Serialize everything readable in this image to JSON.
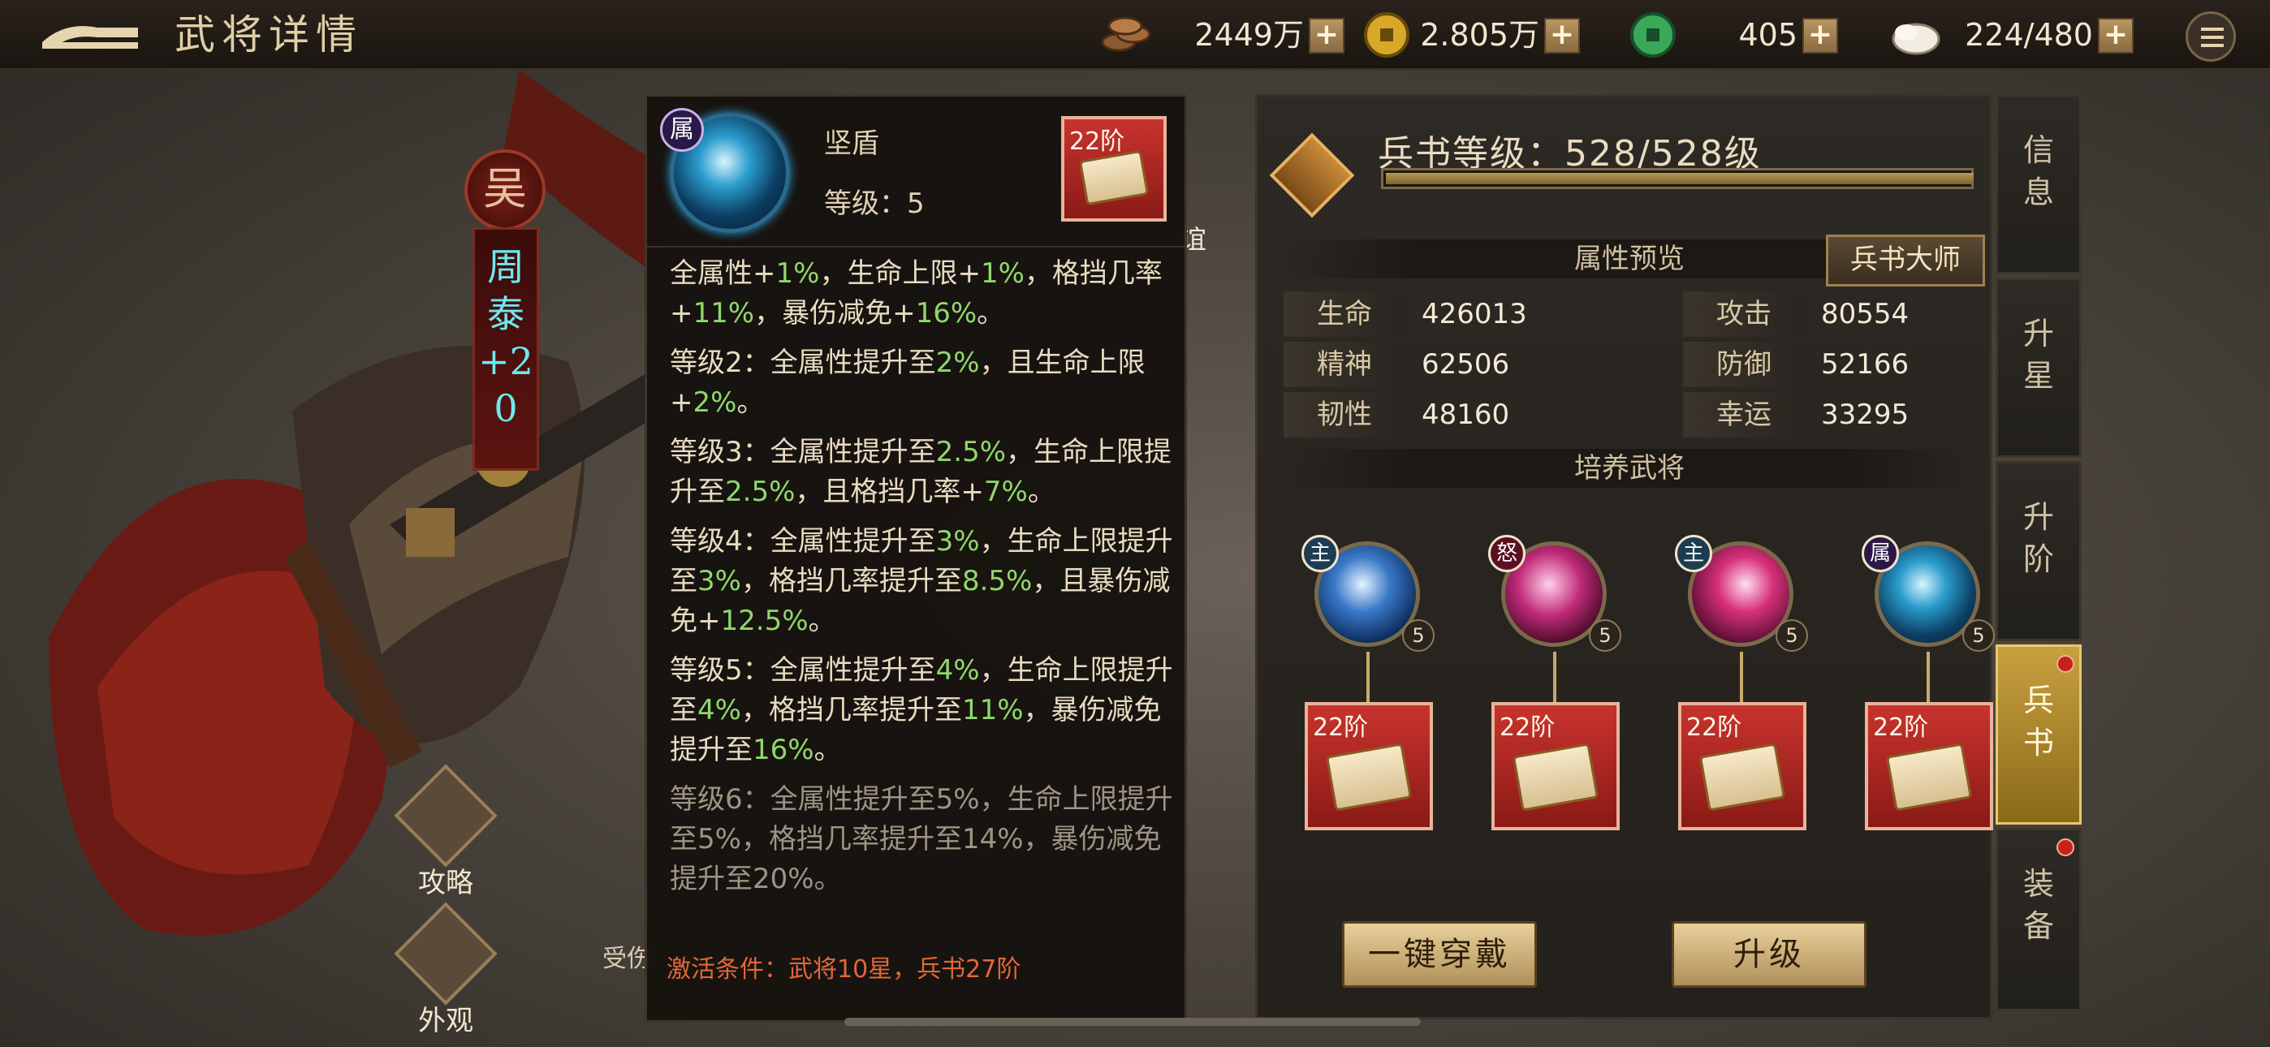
{
  "header": {
    "title": "武将详情",
    "resources": [
      {
        "icon": "copper-coins-icon",
        "value": "2449万"
      },
      {
        "icon": "gold-coin-icon",
        "value": "2.805万"
      },
      {
        "icon": "jade-coin-icon",
        "value": "405"
      },
      {
        "icon": "steamed-bun-icon",
        "value": "224/480"
      }
    ],
    "plus": "+"
  },
  "hero": {
    "faction": "吴",
    "name": "周泰+20",
    "side_buttons": [
      "攻略",
      "外观"
    ],
    "partial_labels": [
      "谊",
      "受伤"
    ]
  },
  "skill_popup": {
    "badge": "属",
    "name": "坚盾",
    "level": "等级：5",
    "book_tier": "22阶",
    "description": [
      {
        "text": "全属性+1%，生命上限+1%，格挡几率+11%，暴伤减免+16%。",
        "segments": [
          {
            "t": "全属性+"
          },
          {
            "t": "1%",
            "c": "green"
          },
          {
            "t": "，生命上限+"
          },
          {
            "t": "1%",
            "c": "green"
          },
          {
            "t": "，格挡几率+"
          },
          {
            "t": "11%",
            "c": "green"
          },
          {
            "t": "，暴伤减免+"
          },
          {
            "t": "16%",
            "c": "green"
          },
          {
            "t": "。"
          }
        ]
      },
      {
        "segments": [
          {
            "t": "等级2：全属性提升至"
          },
          {
            "t": "2%",
            "c": "green"
          },
          {
            "t": "，且生命上限+"
          },
          {
            "t": "2%",
            "c": "green"
          },
          {
            "t": "。"
          }
        ]
      },
      {
        "segments": [
          {
            "t": "等级3：全属性提升至"
          },
          {
            "t": "2.5%",
            "c": "green"
          },
          {
            "t": "，生命上限提升至"
          },
          {
            "t": "2.5%",
            "c": "green"
          },
          {
            "t": "，且格挡几率+"
          },
          {
            "t": "7%",
            "c": "green"
          },
          {
            "t": "。"
          }
        ]
      },
      {
        "segments": [
          {
            "t": "等级4：全属性提升至"
          },
          {
            "t": "3%",
            "c": "green"
          },
          {
            "t": "，生命上限提升至"
          },
          {
            "t": "3%",
            "c": "green"
          },
          {
            "t": "，格挡几率提升至"
          },
          {
            "t": "8.5%",
            "c": "green"
          },
          {
            "t": "，且暴伤减免+"
          },
          {
            "t": "12.5%",
            "c": "green"
          },
          {
            "t": "。"
          }
        ]
      },
      {
        "segments": [
          {
            "t": "等级5：全属性提升至"
          },
          {
            "t": "4%",
            "c": "green"
          },
          {
            "t": "，生命上限提升至"
          },
          {
            "t": "4%",
            "c": "green"
          },
          {
            "t": "，格挡几率提升至"
          },
          {
            "t": "11%",
            "c": "green"
          },
          {
            "t": "，暴伤减免提升至"
          },
          {
            "t": "16%",
            "c": "green"
          },
          {
            "t": "。"
          }
        ]
      },
      {
        "dim": true,
        "segments": [
          {
            "t": "等级6：全属性提升至5%，生命上限提升至5%，格挡几率提升至14%，暴伤减免提升至20%。"
          }
        ]
      }
    ],
    "activation": "激活条件：武将10星，兵书27阶"
  },
  "panel": {
    "book_level_label": "兵书等级：528/528级",
    "book_level_progress": 1.0,
    "attr_preview_title": "属性预览",
    "master_button": "兵书大师",
    "stats": [
      {
        "label": "生命",
        "value": "426013"
      },
      {
        "label": "攻击",
        "value": "80554"
      },
      {
        "label": "精神",
        "value": "62506"
      },
      {
        "label": "防御",
        "value": "52166"
      },
      {
        "label": "韧性",
        "value": "48160"
      },
      {
        "label": "幸运",
        "value": "33295"
      }
    ],
    "train_title": "培养武将",
    "slots": [
      {
        "badge": "主",
        "level": "5",
        "tier": "22阶",
        "badge_color": "#1c3c52"
      },
      {
        "badge": "怒",
        "level": "5",
        "tier": "22阶",
        "badge_color": "#5a1020"
      },
      {
        "badge": "主",
        "level": "5",
        "tier": "22阶",
        "badge_color": "#1c3c52"
      },
      {
        "badge": "属",
        "level": "5",
        "tier": "22阶",
        "badge_color": "#2a1848"
      }
    ],
    "equip_all_button": "一键穿戴",
    "upgrade_button": "升级"
  },
  "tabs": [
    {
      "label": "信息",
      "active": false,
      "dot": false
    },
    {
      "label": "升星",
      "active": false,
      "dot": false
    },
    {
      "label": "升阶",
      "active": false,
      "dot": false
    },
    {
      "label": "兵书",
      "active": true,
      "dot": true
    },
    {
      "label": "装备",
      "active": false,
      "dot": true
    }
  ],
  "colors": {
    "accent_gold": "#e8c98a",
    "highlight_green": "#8fd86a",
    "warning_orange": "#e06838",
    "hero_name_cyan": "#6ee8f0"
  }
}
